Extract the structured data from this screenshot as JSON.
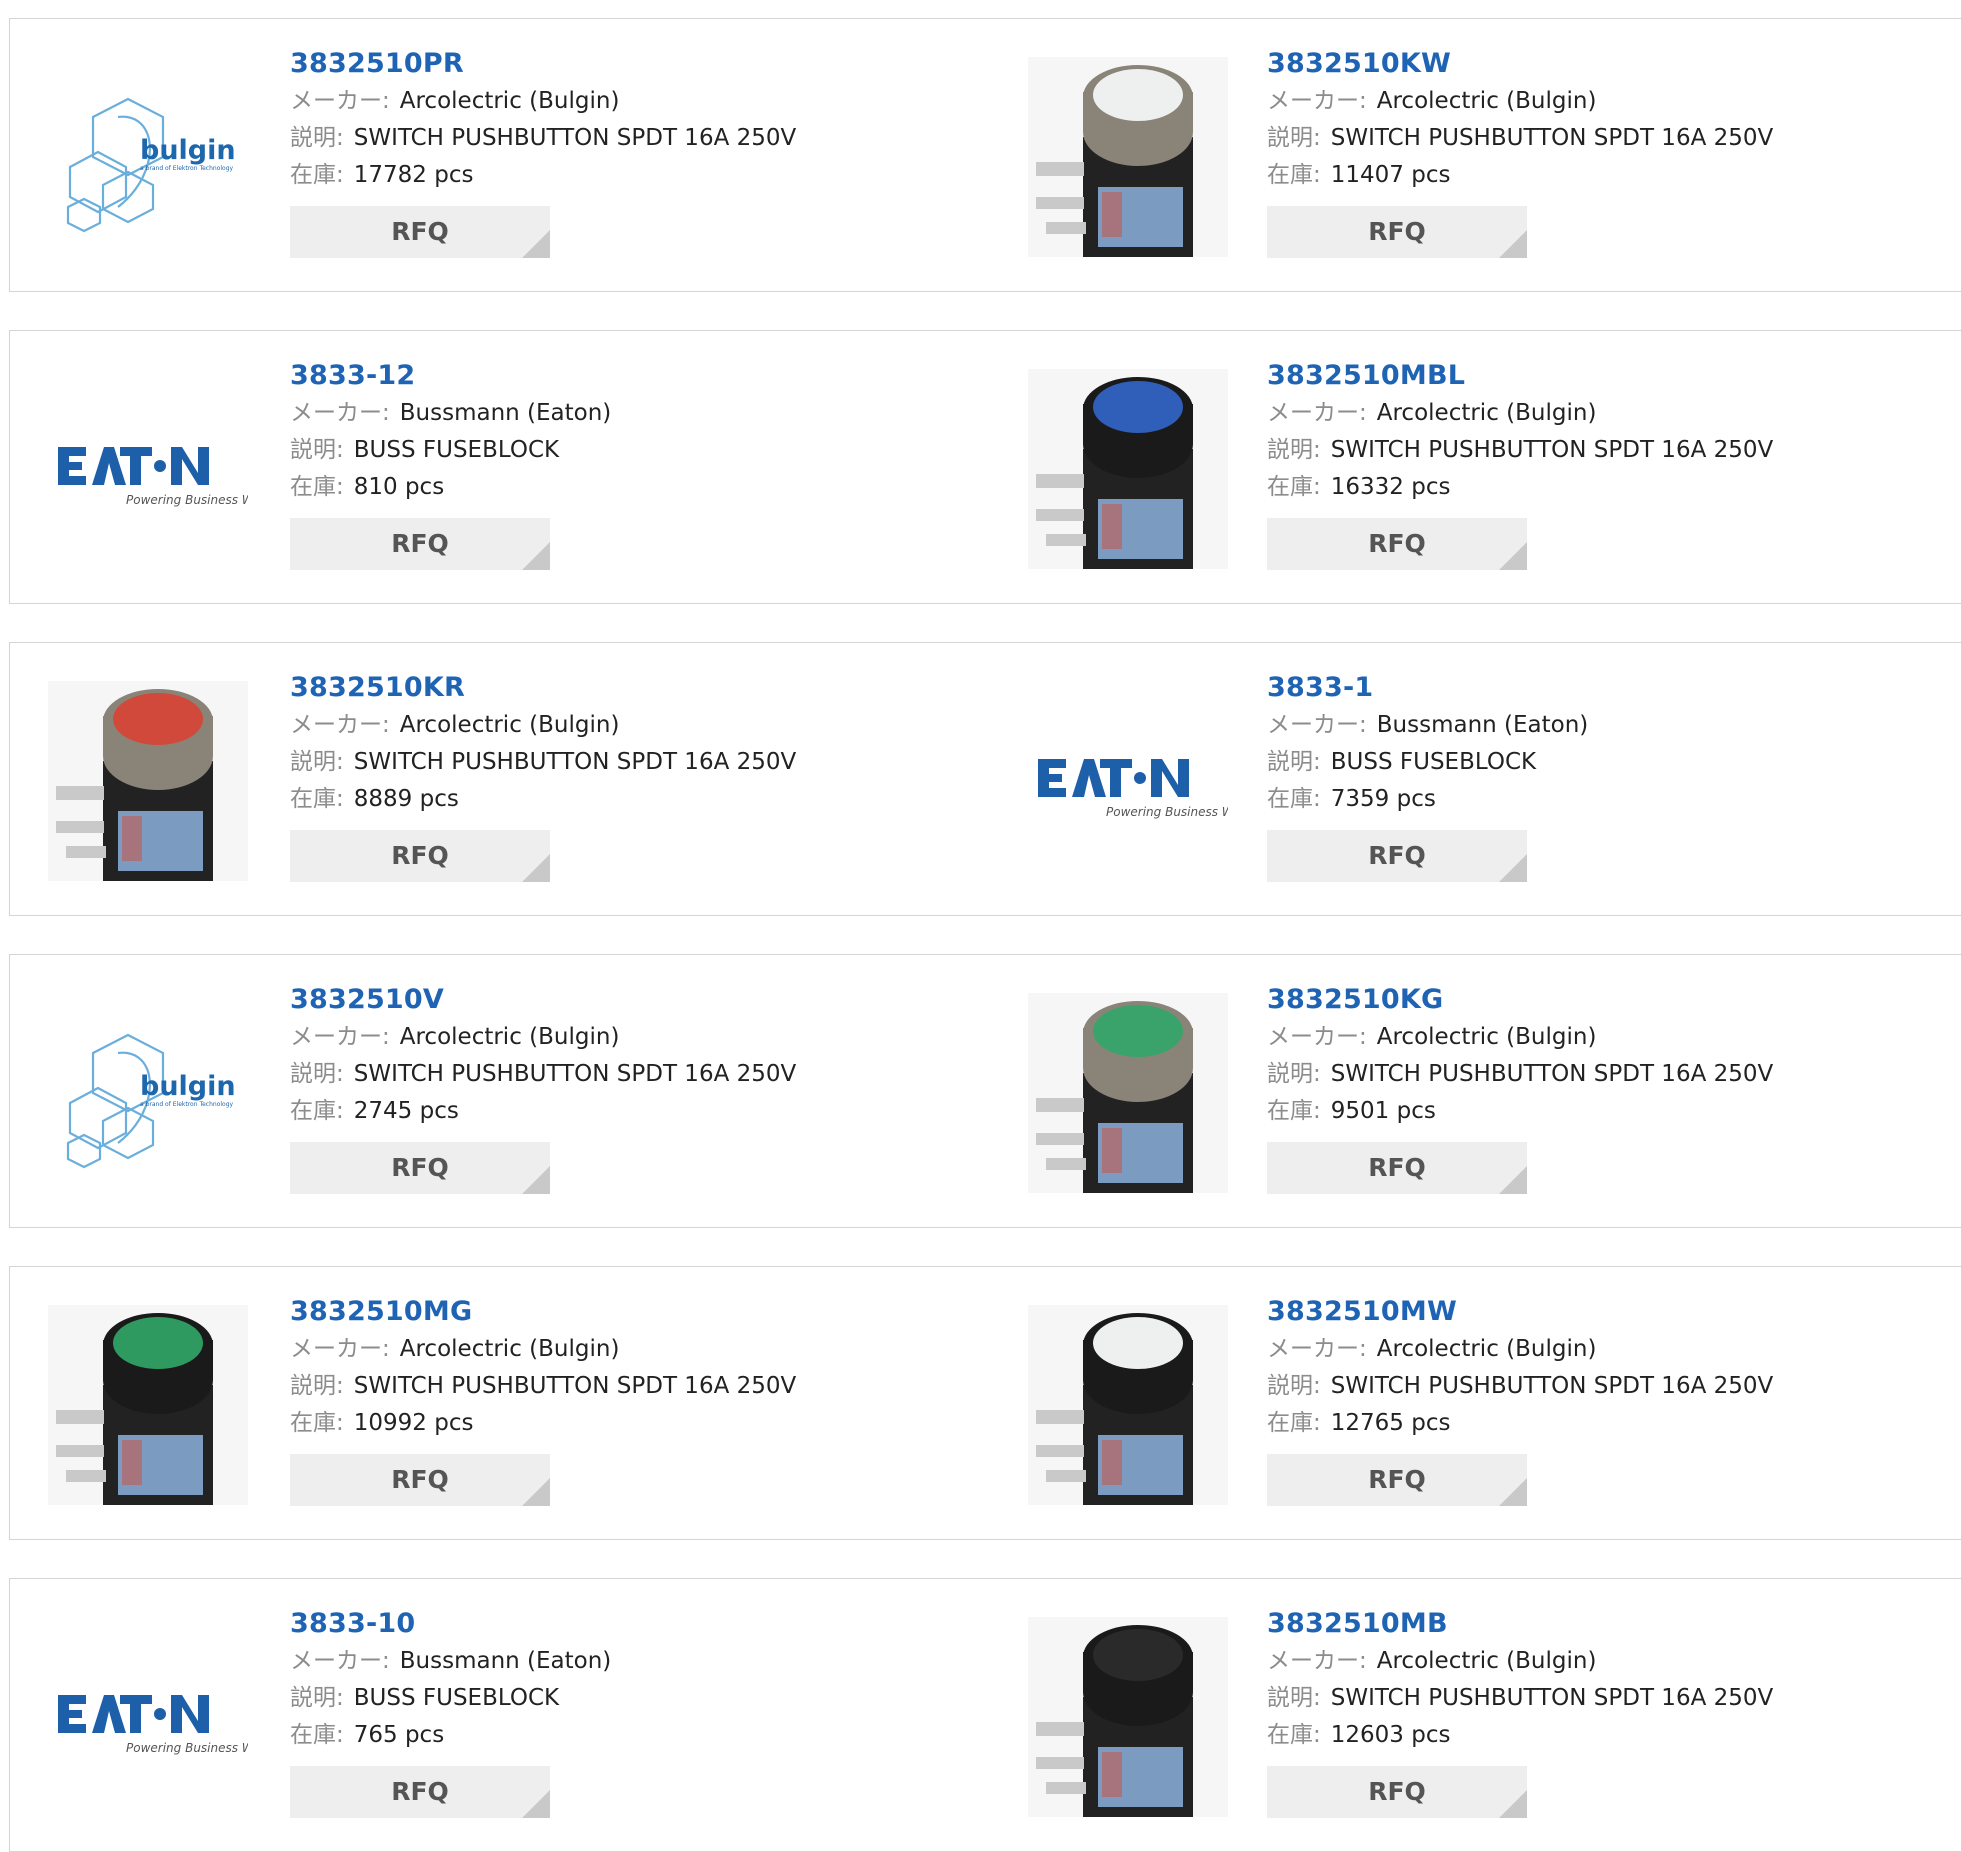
{
  "labels": {
    "maker": "メーカー:",
    "desc": "説明:",
    "stock": "在庫:",
    "rfq": "RFQ"
  },
  "logos": {
    "bulgin_name": "bulgin",
    "bulgin_tag": "a brand of Elektron Technology",
    "eaton_tag": "Powering Business Worldwide"
  },
  "products": [
    {
      "pn": "3832510PR",
      "maker": "Arcolectric (Bulgin)",
      "desc": "SWITCH PUSHBUTTON SPDT 16A 250V",
      "stock": "17782 pcs",
      "image": "bulgin-logo"
    },
    {
      "pn": "3832510KW",
      "maker": "Arcolectric (Bulgin)",
      "desc": "SWITCH PUSHBUTTON SPDT 16A 250V",
      "stock": "11407 pcs",
      "image": "switch",
      "cap": "#eef0ef",
      "bezel": "#8a8478"
    },
    {
      "pn": "3833-12",
      "maker": "Bussmann (Eaton)",
      "desc": "BUSS FUSEBLOCK",
      "stock": "810 pcs",
      "image": "eaton-logo"
    },
    {
      "pn": "3832510MBL",
      "maker": "Arcolectric (Bulgin)",
      "desc": "SWITCH PUSHBUTTON SPDT 16A 250V",
      "stock": "16332 pcs",
      "image": "switch",
      "cap": "#2f5fb8",
      "bezel": "#1a1a1a"
    },
    {
      "pn": "3832510KR",
      "maker": "Arcolectric (Bulgin)",
      "desc": "SWITCH PUSHBUTTON SPDT 16A 250V",
      "stock": "8889 pcs",
      "image": "switch",
      "cap": "#d0493a",
      "bezel": "#8a8478"
    },
    {
      "pn": "3833-1",
      "maker": "Bussmann (Eaton)",
      "desc": "BUSS FUSEBLOCK",
      "stock": "7359 pcs",
      "image": "eaton-logo"
    },
    {
      "pn": "3832510V",
      "maker": "Arcolectric (Bulgin)",
      "desc": "SWITCH PUSHBUTTON SPDT 16A 250V",
      "stock": "2745 pcs",
      "image": "bulgin-logo"
    },
    {
      "pn": "3832510KG",
      "maker": "Arcolectric (Bulgin)",
      "desc": "SWITCH PUSHBUTTON SPDT 16A 250V",
      "stock": "9501 pcs",
      "image": "switch",
      "cap": "#3aa36b",
      "bezel": "#8a8478"
    },
    {
      "pn": "3832510MG",
      "maker": "Arcolectric (Bulgin)",
      "desc": "SWITCH PUSHBUTTON SPDT 16A 250V",
      "stock": "10992 pcs",
      "image": "switch",
      "cap": "#2f9a60",
      "bezel": "#1a1a1a"
    },
    {
      "pn": "3832510MW",
      "maker": "Arcolectric (Bulgin)",
      "desc": "SWITCH PUSHBUTTON SPDT 16A 250V",
      "stock": "12765 pcs",
      "image": "switch",
      "cap": "#eef0ef",
      "bezel": "#1a1a1a"
    },
    {
      "pn": "3833-10",
      "maker": "Bussmann (Eaton)",
      "desc": "BUSS FUSEBLOCK",
      "stock": "765 pcs",
      "image": "eaton-logo"
    },
    {
      "pn": "3832510MB",
      "maker": "Arcolectric (Bulgin)",
      "desc": "SWITCH PUSHBUTTON SPDT 16A 250V",
      "stock": "12603 pcs",
      "image": "switch",
      "cap": "#2a2a2a",
      "bezel": "#1a1a1a"
    }
  ]
}
